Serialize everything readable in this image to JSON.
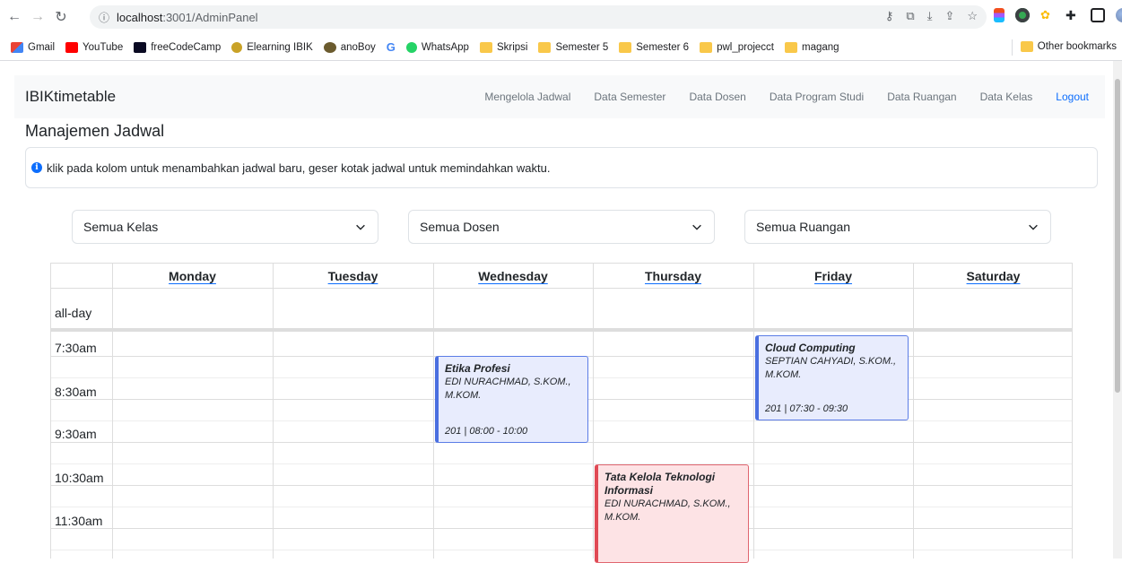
{
  "browser": {
    "url_host": "localhost",
    "url_path": ":3001/AdminPanel",
    "bookmarks": [
      "Gmail",
      "YouTube",
      "freeCodeCamp",
      "Elearning IBIK",
      "anoBoy",
      "",
      "WhatsApp",
      "Skripsi",
      "Semester 5",
      "Semester 6",
      "pwl_projecct",
      "magang"
    ],
    "other_bookmarks": "Other bookmarks"
  },
  "navbar": {
    "brand": "IBIKtimetable",
    "links": [
      "Mengelola Jadwal",
      "Data Semester",
      "Data Dosen",
      "Data Program Studi",
      "Data Ruangan",
      "Data Kelas",
      "Logout"
    ]
  },
  "page": {
    "title": "Manajemen Jadwal",
    "alert": "klik pada kolom untuk menambahkan jadwal baru, geser kotak jadwal untuk memindahkan waktu."
  },
  "filters": {
    "kelas": "Semua Kelas",
    "dosen": "Semua Dosen",
    "ruangan": "Semua Ruangan"
  },
  "calendar": {
    "days": [
      "Monday",
      "Tuesday",
      "Wednesday",
      "Thursday",
      "Friday",
      "Saturday"
    ],
    "allday_label": "all-day",
    "times": [
      "7:30am",
      "8:30am",
      "9:30am",
      "10:30am",
      "11:30am"
    ],
    "events": [
      {
        "title": "Etika Profesi",
        "lecturer": "EDI NURACHMAD, S.KOM., M.KOM.",
        "meta": "201 | 08:00 - 10:00",
        "day": "Wednesday"
      },
      {
        "title": "Cloud Computing",
        "lecturer": "SEPTIAN CAHYADI, S.KOM., M.KOM.",
        "meta": "201 | 07:30 - 09:30",
        "day": "Friday"
      },
      {
        "title": "Tata Kelola Teknologi Informasi",
        "lecturer": "EDI NURACHMAD, S.KOM., M.KOM.",
        "meta": "",
        "day": "Thursday"
      }
    ]
  },
  "colors": {
    "primary": "#0d6efd",
    "event_blue_bg": "#e8ecfd",
    "event_red_bg": "#fde3e5"
  }
}
